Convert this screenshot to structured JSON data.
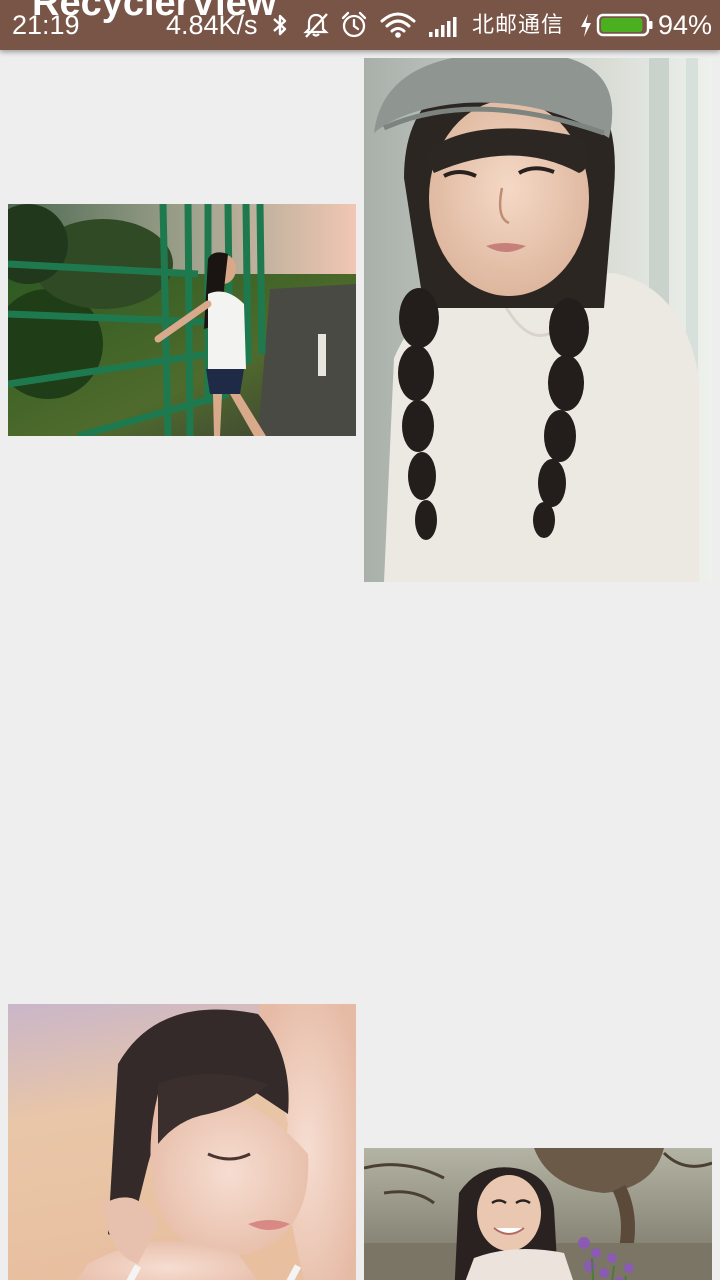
{
  "app": {
    "title": "RecyclerView",
    "toolbar_color": "#795548"
  },
  "status_bar": {
    "time": "21:19",
    "network_speed": "4.84K/s",
    "carrier": "北邮通信",
    "battery_percent": "94%",
    "battery_level": 0.94,
    "battery_color": "#4caf1f",
    "icons": [
      "bluetooth-icon",
      "notifications-off-icon",
      "alarm-clock-icon",
      "wifi-icon",
      "cellular-signal-icon",
      "charging-bolt-icon",
      "battery-icon"
    ]
  },
  "feed": {
    "background": "#eeeeee",
    "items": [
      {
        "id": "photo-1",
        "description": "girl leaning on green fence"
      },
      {
        "id": "photo-2",
        "description": "girl with braids and grey beret"
      },
      {
        "id": "photo-3",
        "description": "girl with wet hair, eyes closed"
      },
      {
        "id": "photo-4",
        "description": "girl holding purple flowers under tree"
      }
    ]
  }
}
